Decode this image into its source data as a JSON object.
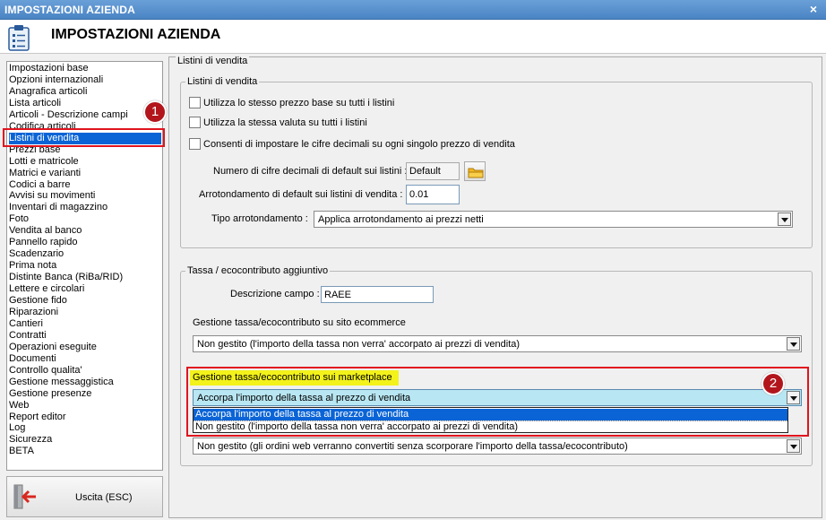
{
  "window": {
    "title": "IMPOSTAZIONI AZIENDA",
    "close_glyph": "×"
  },
  "header": {
    "title": "IMPOSTAZIONI AZIENDA",
    "icon": "clipboard-icon"
  },
  "sidebar": {
    "items": [
      "Impostazioni base",
      "Opzioni internazionali",
      "Anagrafica articoli",
      "Lista articoli",
      "Articoli - Descrizione campi",
      "Codifica articoli",
      "Listini di vendita",
      "Prezzi base",
      "Lotti e matricole",
      "Matrici e varianti",
      "Codici a barre",
      "Avvisi su movimenti",
      "Inventari di magazzino",
      "Foto",
      "Vendita al banco",
      "Pannello rapido",
      "Scadenzario",
      "Prima nota",
      "Distinte Banca (RiBa/RID)",
      "Lettere e circolari",
      "Gestione fido",
      "Riparazioni",
      "Cantieri",
      "Contratti",
      "Operazioni eseguite",
      "Documenti",
      "Controllo qualita'",
      "Gestione messaggistica",
      "Gestione presenze",
      "Web",
      "Report editor",
      "Log",
      "Sicurezza",
      "BETA"
    ],
    "selected_index": 6
  },
  "badges": {
    "one": "1",
    "two": "2"
  },
  "exit_button": {
    "label": "Uscita (ESC)",
    "icon": "exit-door-icon"
  },
  "main": {
    "outer_group": "Listini di vendita",
    "listini_group": {
      "label": "Listini di vendita",
      "checkboxes": [
        "Utilizza lo stesso prezzo base su tutti i listini",
        "Utilizza la stessa valuta su tutti i listini",
        "Consenti di impostare le cifre decimali su ogni singolo prezzo di vendita"
      ],
      "decimals_label": "Numero di cifre decimali di default sui listini :",
      "decimals_value": "Default",
      "rounding_label": "Arrotondamento di default sui listini di vendita :",
      "rounding_value": "0.01",
      "rounding_type_label": "Tipo arrotondamento :",
      "rounding_type_value": "Applica arrotondamento ai prezzi netti"
    },
    "tax_group": {
      "label": "Tassa / ecocontributo aggiuntivo",
      "field_desc_label": "Descrizione campo :",
      "field_desc_value": "RAEE",
      "ecommerce_label": "Gestione tassa/ecocontributo su sito ecommerce",
      "ecommerce_value": "Non gestito (l'importo della tassa non verra' accorpato ai prezzi di vendita)",
      "marketplace_label": "Gestione tassa/ecocontributo sui marketplace",
      "marketplace_value": "Accorpa l'importo della tassa al prezzo di vendita",
      "marketplace_options": [
        "Accorpa l'importo della tassa al prezzo di vendita",
        "Non gestito (l'importo della tassa non verra' accorpato ai prezzi di vendita)"
      ],
      "web_orders_value": "Non gestito (gli ordini web verranno convertiti senza scorporare l'importo della tassa/ecocontributo)"
    }
  },
  "colors": {
    "title_bar": "#4a84c4",
    "selection": "#0a64d6",
    "highlight_red": "#e0141e",
    "badge": "#b2161c",
    "yellow": "#f3f21b",
    "active_select": "#b8e6f2"
  }
}
